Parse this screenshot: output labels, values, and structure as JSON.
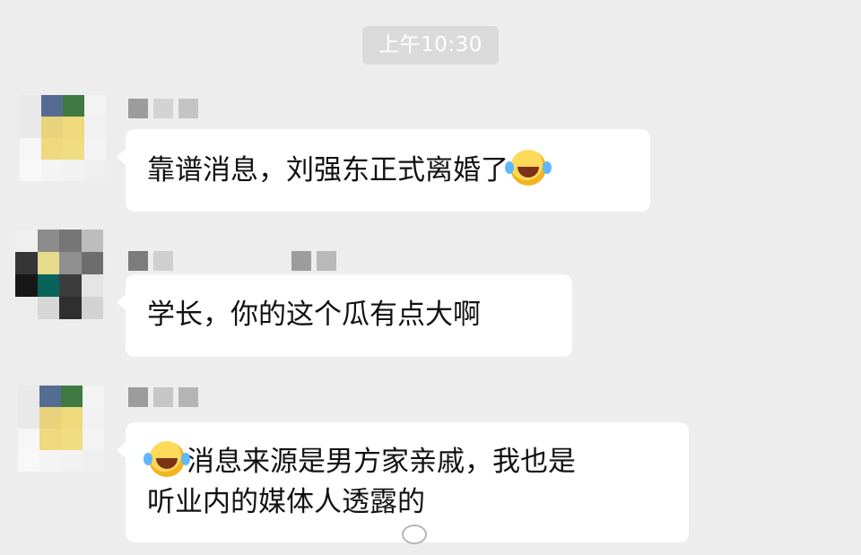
{
  "time": "上午10:30",
  "messages": [
    {
      "text": "靠谱消息，刘强东正式离婚了",
      "emoji_position": "end",
      "emoji_name": "laughing-tears-emoji"
    },
    {
      "text": "学长，你的这个瓜有点大啊"
    },
    {
      "emoji_position": "start",
      "emoji_name": "laughing-tears-emoji",
      "line1": "消息来源是男方家亲戚，我也是",
      "line2": "听业内的媒体人透露的"
    }
  ],
  "watermark": {
    "icon": "weibo-icon"
  },
  "colors": {
    "background": "#ededed",
    "bubble": "#ffffff",
    "text": "#111111",
    "timestamp_bg": "#dadada"
  }
}
